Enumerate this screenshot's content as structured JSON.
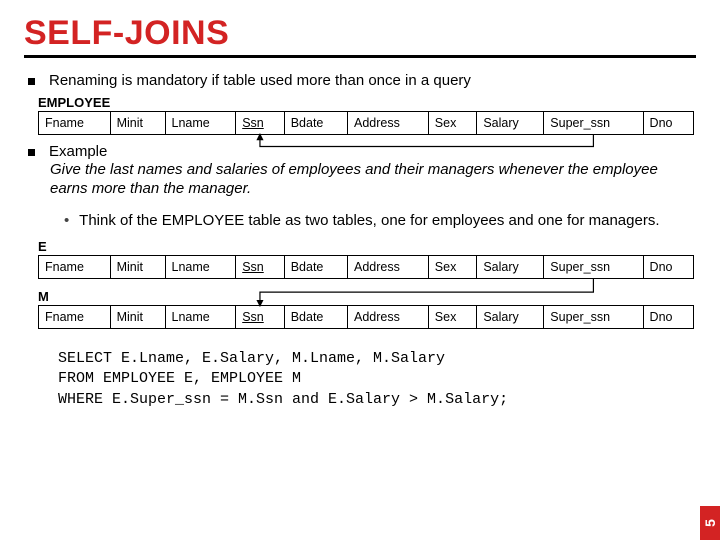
{
  "title": "SELF-JOINS",
  "bullet1": "Renaming is mandatory if table used more than once in a query",
  "labels": {
    "employee": "EMPLOYEE",
    "e": "E",
    "m": "M"
  },
  "cols": {
    "fname": "Fname",
    "minit": "Minit",
    "lname": "Lname",
    "ssn": "Ssn",
    "bdate": "Bdate",
    "address": "Address",
    "sex": "Sex",
    "salary": "Salary",
    "super_ssn": "Super_ssn",
    "dno": "Dno"
  },
  "example_head": "Example",
  "example_body": "Give the last names and salaries of employees and their managers whenever the employee earns more than the manager.",
  "sub": "Think of the EMPLOYEE table as two tables, one for employees and one for managers.",
  "sql": {
    "l1": "SELECT E.Lname, E.Salary, M.Lname, M.Salary",
    "l2": "FROM EMPLOYEE E, EMPLOYEE M",
    "l3": "WHERE E.Super_ssn = M.Ssn and E.Salary > M.Salary;"
  },
  "pagenum": "5"
}
